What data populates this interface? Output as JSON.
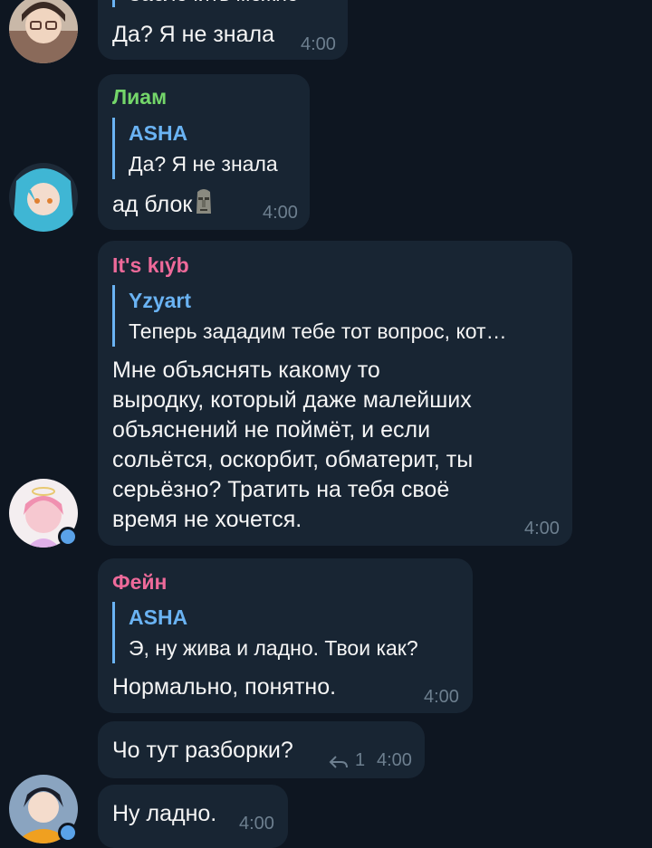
{
  "messages": [
    {
      "reply_text_partial": "Заблочить можно",
      "text": "Да? Я не знала",
      "time": "4:00"
    },
    {
      "sender": "Лиам",
      "sender_color": "#74d66a",
      "reply_name": "ASHA",
      "reply_text": "Да? Я не знала",
      "text": "ад блок",
      "emoji": "moai-icon",
      "time": "4:00"
    },
    {
      "sender": "It's kıýb",
      "sender_color": "#ee6a9a",
      "reply_name": "Yzyart",
      "reply_text": "Теперь зададим тебе тот вопрос, кот…",
      "text_lines": [
        "Мне объяснять какому то",
        "выродку, который даже малейших",
        "объяснений не поймёт, и если",
        "сольётся, оскорбит, обматерит, ты",
        "серьёзно? Тратить на тебя своё",
        "время не хочется."
      ],
      "time": "4:00"
    },
    {
      "sender": "Фейн",
      "sender_color": "#ee6a9a",
      "reply_name": "ASHA",
      "reply_text": "Э, ну жива и ладно. Твои как?",
      "text": "Нормально, понятно.",
      "time": "4:00"
    },
    {
      "text": "Чо тут разборки?",
      "reply_count": "1",
      "time": "4:00"
    },
    {
      "text": "Ну ладно.",
      "time": "4:00"
    }
  ]
}
